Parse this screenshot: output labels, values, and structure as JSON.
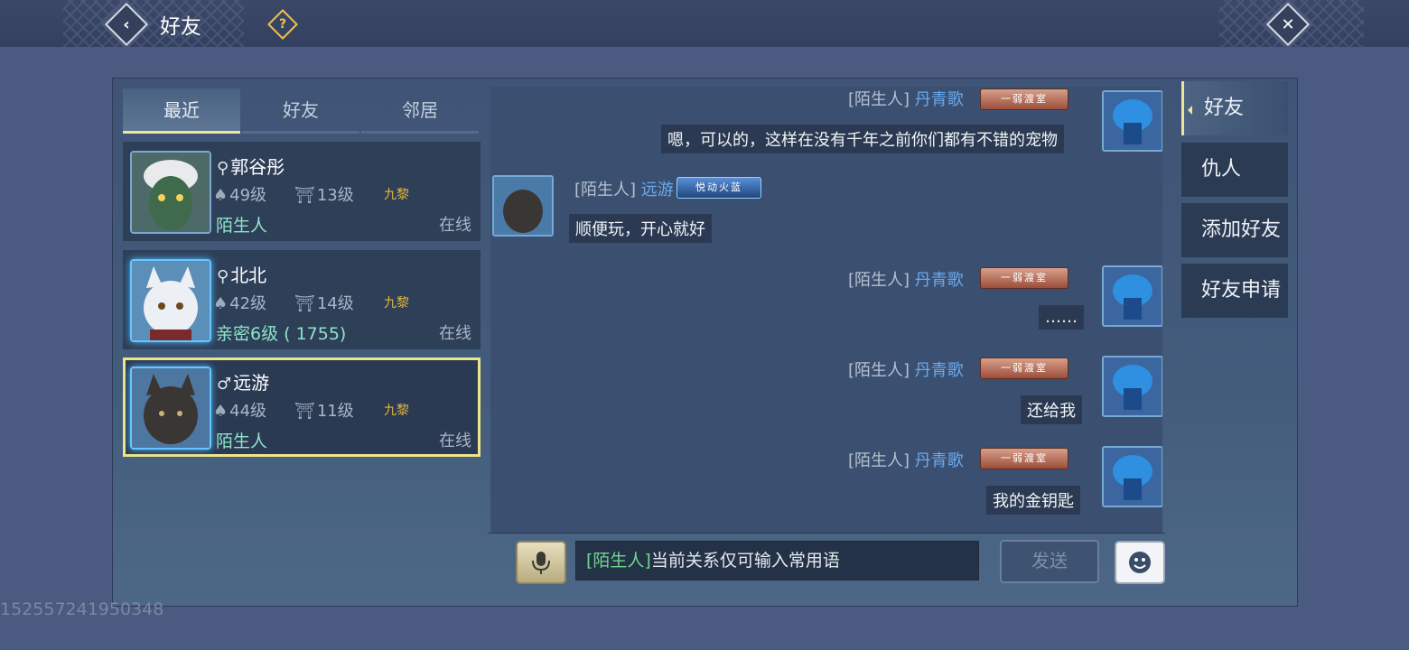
{
  "header": {
    "title": "好友",
    "help_glyph": "?",
    "back_glyph": "‹",
    "close_glyph": "✕"
  },
  "tabs": [
    {
      "label": "最近",
      "active": true
    },
    {
      "label": "好友",
      "active": false
    },
    {
      "label": "邻居",
      "active": false
    }
  ],
  "friends": [
    {
      "name": "郭谷彤",
      "gender_icon": "search-gender-icon",
      "level": "49级",
      "house_level": "13级",
      "server": "九黎",
      "relation": "陌生人",
      "status": "在线"
    },
    {
      "name": "北北",
      "gender_icon": "search-gender-icon",
      "level": "42级",
      "house_level": "14级",
      "server": "九黎",
      "relation": "亲密6级 ( 1755)",
      "status": "在线"
    },
    {
      "name": "远游",
      "gender_icon": "male-icon",
      "level": "44级",
      "house_level": "11级",
      "server": "九黎",
      "relation": "陌生人",
      "status": "在线",
      "selected": true
    }
  ],
  "chat": {
    "messages": [
      {
        "prefix": "[陌生人]",
        "name": "丹青歌",
        "badge": "一弱渡室",
        "text": "嗯，可以的，这样在没有千年之前你们都有不错的宠物",
        "side": "right"
      },
      {
        "prefix": "[陌生人]",
        "name": "远游",
        "badge": "悦动火蓝",
        "text": "顺便玩，开心就好",
        "side": "left"
      },
      {
        "prefix": "[陌生人]",
        "name": "丹青歌",
        "badge": "一弱渡室",
        "text": "……",
        "side": "right"
      },
      {
        "prefix": "[陌生人]",
        "name": "丹青歌",
        "badge": "一弱渡室",
        "text": "还给我",
        "side": "right"
      },
      {
        "prefix": "[陌生人]",
        "name": "丹青歌",
        "badge": "一弱渡室",
        "text": "我的金钥匙",
        "side": "right"
      }
    ],
    "input_tag": "[陌生人]",
    "input_hint": "当前关系仅可输入常用语",
    "send_label": "发送"
  },
  "side_tabs": [
    {
      "label": "好友",
      "active": true
    },
    {
      "label": "仇人",
      "active": false
    },
    {
      "label": "添加好友",
      "active": false
    },
    {
      "label": "好友申请",
      "active": false
    }
  ],
  "uid": "152557241950348",
  "colors": {
    "accent": "#f1e49a",
    "name_blue": "#68a9ee",
    "relation_green": "#8fe3c9",
    "server_gold": "#e8b63c"
  }
}
